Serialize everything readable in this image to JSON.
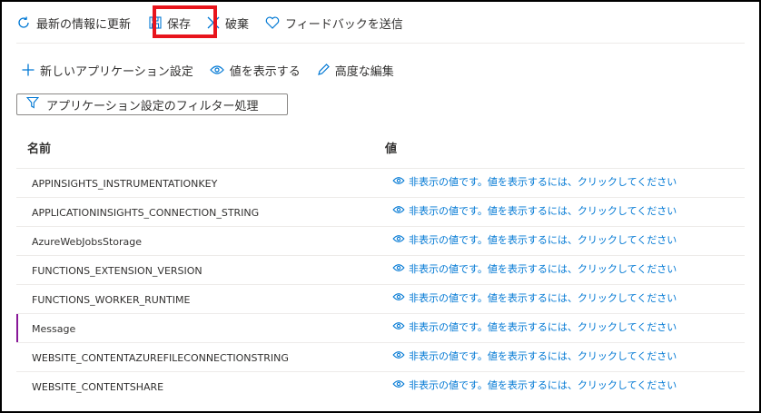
{
  "toolbar": {
    "refresh_label": "最新の情報に更新",
    "save_label": "保存",
    "discard_label": "破棄",
    "feedback_label": "フィードバックを送信"
  },
  "commands": {
    "new_setting_label": "新しいアプリケーション設定",
    "show_values_label": "値を表示する",
    "advanced_edit_label": "高度な編集"
  },
  "filter": {
    "label": "アプリケーション設定のフィルター処理"
  },
  "table": {
    "columns": [
      "名前",
      "値"
    ],
    "hidden_value_text": "非表示の値です。値を表示するには、クリックしてください",
    "rows": [
      {
        "name": "APPINSIGHTS_INSTRUMENTATIONKEY"
      },
      {
        "name": "APPLICATIONINSIGHTS_CONNECTION_STRING"
      },
      {
        "name": "AzureWebJobsStorage"
      },
      {
        "name": "FUNCTIONS_EXTENSION_VERSION"
      },
      {
        "name": "FUNCTIONS_WORKER_RUNTIME"
      },
      {
        "name": "Message"
      },
      {
        "name": "WEBSITE_CONTENTAZUREFILECONNECTIONSTRING"
      },
      {
        "name": "WEBSITE_CONTENTSHARE"
      }
    ]
  },
  "colors": {
    "accent": "#0078d4",
    "highlight_box": "#e8141c",
    "selected_row_marker": "#881798"
  }
}
